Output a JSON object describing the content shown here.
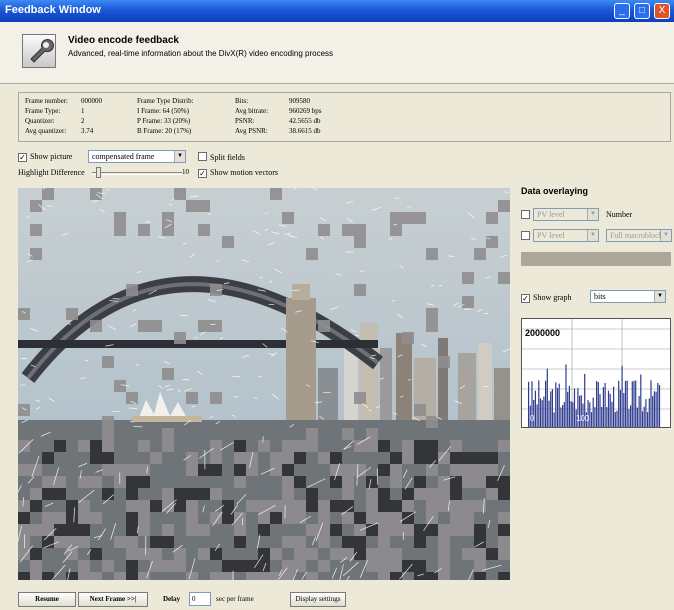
{
  "window": {
    "title": "Feedback Window",
    "controls": {
      "minimize": "_",
      "maximize": "□",
      "close": "X"
    }
  },
  "header": {
    "icon": "wrench-icon",
    "title": "Video encode feedback",
    "subtitle": "Advanced, real-time information about the DivX(R) video encoding process"
  },
  "stats": {
    "col1": [
      {
        "label": "Frame number:",
        "value": "000000"
      },
      {
        "label": "Frame Type:",
        "value": "1"
      },
      {
        "label": "Quantizer:",
        "value": "2"
      },
      {
        "label": "Avg quantizer:",
        "value": "3.74"
      }
    ],
    "col2": [
      {
        "text": "Frame Type Distrib:"
      },
      {
        "text": "I Frame: 64 (50%)"
      },
      {
        "text": "P Frame: 33 (20%)"
      },
      {
        "text": "B Frame: 20 (17%)"
      }
    ],
    "col3": [
      {
        "label": "Bits:",
        "value": "909580"
      },
      {
        "label": "Avg bitrate:",
        "value": "960269 bps"
      },
      {
        "label": "PSNR:",
        "value": "42.5655 db"
      },
      {
        "label": "Avg PSNR:",
        "value": "38.6615 db"
      }
    ]
  },
  "controls": {
    "show_picture": {
      "label": "Show picture",
      "checked": true
    },
    "picture_mode": "compensated frame",
    "split_fields": {
      "label": "Split fields",
      "checked": false
    },
    "highlight_difference": {
      "label": "Highlight Difference",
      "value": "10",
      "slider_fraction": 0.05
    },
    "show_motion_vectors": {
      "label": "Show motion vectors",
      "checked": true
    }
  },
  "data_overlaying": {
    "title": "Data overlaying",
    "row1": {
      "checked": false,
      "select": "PV level",
      "label": "Number"
    },
    "row2": {
      "checked": false,
      "select1": "PV level",
      "select2": "Full macroblock"
    },
    "show_graph": {
      "label": "Show graph",
      "checked": true,
      "select": "bits"
    },
    "graph": {
      "top_label": "2000000",
      "bottom_left": "0",
      "bottom_right": "100"
    }
  },
  "bottom": {
    "resume": "Resume",
    "next_frame": "Next Frame >>|",
    "delay_label": "Delay",
    "delay_value": "0",
    "delay_unit": "sec per frame",
    "display_settings": "Display settings"
  },
  "colors": {
    "titlebar": "#1a58d6",
    "panel": "#ece9d8",
    "graph_bars": "#2f3b8f",
    "block_gray": "#8f8d8e"
  }
}
